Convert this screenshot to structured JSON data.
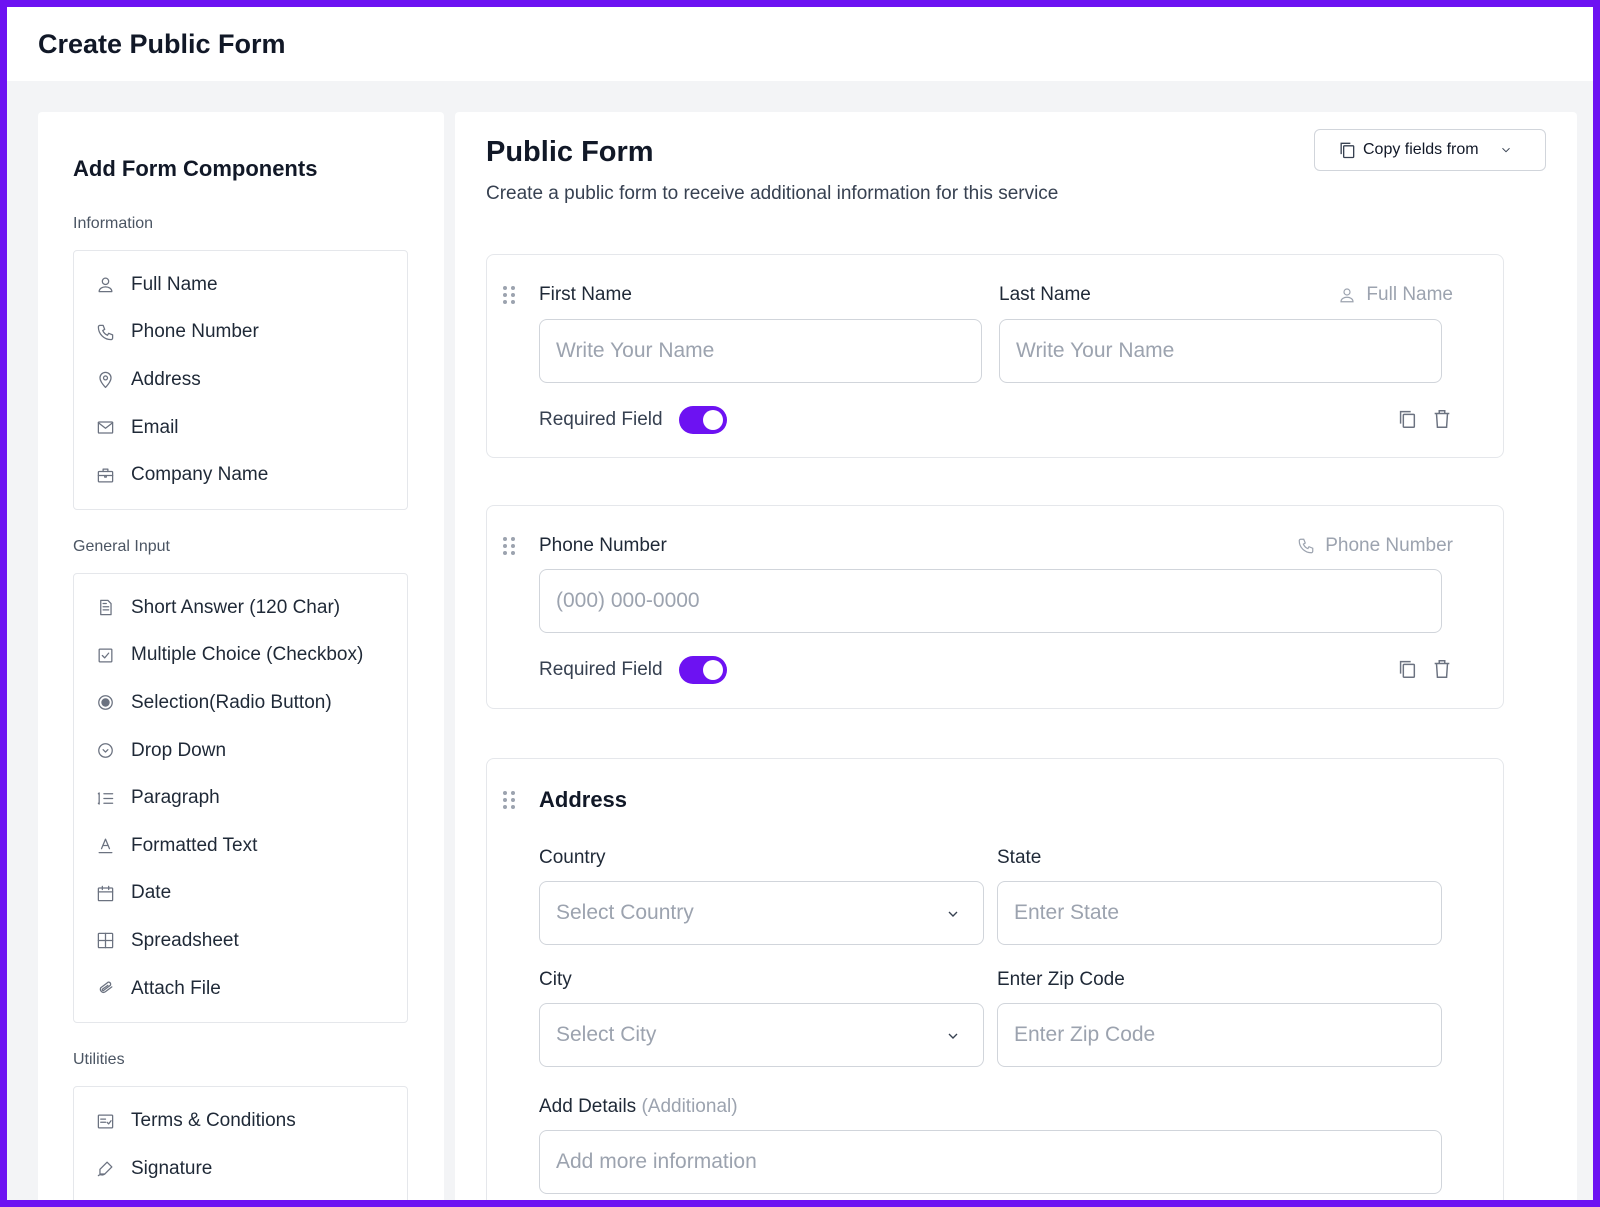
{
  "page": {
    "title": "Create Public Form"
  },
  "colors": {
    "accent": "#6d12f2",
    "frame": "#6d12f2"
  },
  "sidebar": {
    "title": "Add Form Components",
    "sections": [
      {
        "label": "Information",
        "items": [
          {
            "label": "Full Name",
            "icon": "user-icon"
          },
          {
            "label": "Phone Number",
            "icon": "phone-icon"
          },
          {
            "label": "Address",
            "icon": "map-pin-icon"
          },
          {
            "label": "Email",
            "icon": "mail-icon"
          },
          {
            "label": "Company Name",
            "icon": "briefcase-icon"
          }
        ]
      },
      {
        "label": "General Input",
        "items": [
          {
            "label": "Short Answer (120 Char)",
            "icon": "document-icon"
          },
          {
            "label": "Multiple Choice (Checkbox)",
            "icon": "checkbox-icon"
          },
          {
            "label": "Selection(Radio Button)",
            "icon": "radio-icon"
          },
          {
            "label": "Drop Down",
            "icon": "chevron-circle-icon"
          },
          {
            "label": "Paragraph",
            "icon": "list-icon"
          },
          {
            "label": "Formatted Text",
            "icon": "text-format-icon"
          },
          {
            "label": "Date",
            "icon": "calendar-icon"
          },
          {
            "label": "Spreadsheet",
            "icon": "grid-icon"
          },
          {
            "label": "Attach File",
            "icon": "paperclip-icon"
          }
        ]
      },
      {
        "label": "Utilities",
        "items": [
          {
            "label": "Terms & Conditions",
            "icon": "terms-icon"
          },
          {
            "label": "Signature",
            "icon": "signature-icon"
          }
        ]
      }
    ]
  },
  "main": {
    "title": "Public Form",
    "subtitle": "Create a public form to receive additional information for this service",
    "copy_button": "Copy fields from",
    "name_card": {
      "first_label": "First Name",
      "last_label": "Last Name",
      "tag": "Full Name",
      "first_placeholder": "Write Your Name",
      "last_placeholder": "Write Your Name",
      "required_label": "Required Field"
    },
    "phone_card": {
      "label": "Phone Number",
      "tag": "Phone Number",
      "placeholder": "(000) 000-0000",
      "required_label": "Required Field"
    },
    "address_card": {
      "title": "Address",
      "country_label": "Country",
      "country_placeholder": "Select Country",
      "state_label": "State",
      "state_placeholder": "Enter State",
      "city_label": "City",
      "city_placeholder": "Select City",
      "zip_label": "Enter Zip Code",
      "zip_placeholder": "Enter Zip Code",
      "details_label": "Add Details",
      "details_hint": "(Additional)",
      "details_placeholder": "Add more information"
    }
  }
}
